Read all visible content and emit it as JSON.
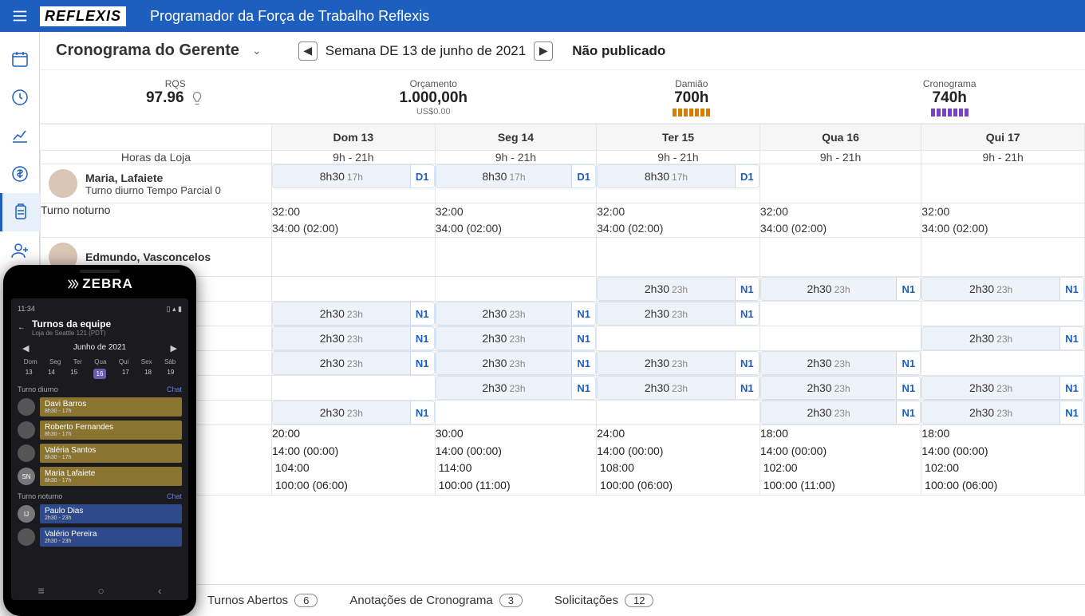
{
  "header": {
    "logo": "REFLEXIS",
    "app_title": "Programador da Força de Trabalho Reflexis"
  },
  "page": {
    "title": "Cronograma do Gerente",
    "week_label": "Semana DE 13 de junho de 2021",
    "publish_status": "Não publicado"
  },
  "summary": {
    "rqs": {
      "label": "RQS",
      "value": "97.96"
    },
    "budget": {
      "label": "Orçamento",
      "value": "1.000,00h",
      "sub": "US$0.00"
    },
    "damiao": {
      "label": "Damião",
      "value": "700h"
    },
    "cronograma": {
      "label": "Cronograma",
      "value": "740h"
    }
  },
  "days": [
    "Dom 13",
    "Seg 14",
    "Ter 15",
    "Qua 16",
    "Qui 17"
  ],
  "store_hours": {
    "label": "Horas da Loja",
    "value": "9h - 21h"
  },
  "employees": {
    "maria": {
      "name": "Maria, Lafaiete",
      "sub": "Turno diurno Tempo Parcial 0"
    },
    "edmundo": {
      "name": "Edmundo, Vasconcelos"
    }
  },
  "shifts": {
    "d830": {
      "time": "8h30",
      "end": "17h",
      "badge": "D1"
    },
    "n230": {
      "time": "2h30",
      "end": "23h",
      "badge": "N1"
    }
  },
  "night": {
    "label": "Turno noturno",
    "line1": "32:00",
    "line2": "34:00 (02:00)"
  },
  "totals": {
    "c0": {
      "a": "20:00",
      "b": "14:00 (00:00)",
      "c": "104:00",
      "d": "100:00 (06:00)"
    },
    "c1": {
      "a": "30:00",
      "b": "14:00 (00:00)",
      "c": "114:00",
      "d": "100:00 (11:00)"
    },
    "c2": {
      "a": "24:00",
      "b": "14:00 (00:00)",
      "c": "108:00",
      "d": "100:00 (06:00)"
    },
    "c3": {
      "a": "18:00",
      "b": "14:00 (00:00)",
      "c": "102:00",
      "d": "100:00 (11:00)"
    },
    "c4": {
      "a": "18:00",
      "b": "14:00 (00:00)",
      "c": "102:00",
      "d": "100:00 (06:00)"
    }
  },
  "bottom": {
    "turnos": {
      "label": "Turnos Abertos",
      "count": "6"
    },
    "anot": {
      "label": "Anotações de Cronograma",
      "count": "3"
    },
    "solic": {
      "label": "Solicitações",
      "count": "12"
    }
  },
  "mobile": {
    "brand": "ZEBRA",
    "time": "11:34",
    "title": "Turnos da equipe",
    "sub": "Loja de Seattle 121 (PDT)",
    "month": "Junho de 2021",
    "dow": [
      "Dom",
      "Seg",
      "Ter",
      "Qua",
      "Qui",
      "Sex",
      "Sáb"
    ],
    "dates": [
      "13",
      "14",
      "15",
      "16",
      "17",
      "18",
      "19"
    ],
    "section_day": "Turno diurno",
    "section_night": "Turno noturno",
    "chat": "Chat",
    "people_day": [
      {
        "name": "Davi Barros",
        "time": "8h30 - 17h"
      },
      {
        "name": "Roberto Fernandes",
        "time": "8h30 - 17h"
      },
      {
        "name": "Valéria Santos",
        "time": "8h30 - 17h"
      },
      {
        "name": "Maria Lafaiete",
        "time": "8h30 - 17h",
        "initials": "SN"
      }
    ],
    "people_night": [
      {
        "name": "Paulo Dias",
        "time": "2h30 - 23h",
        "initials": "IJ"
      },
      {
        "name": "Valério Pereira",
        "time": "2h30 - 23h"
      }
    ]
  }
}
